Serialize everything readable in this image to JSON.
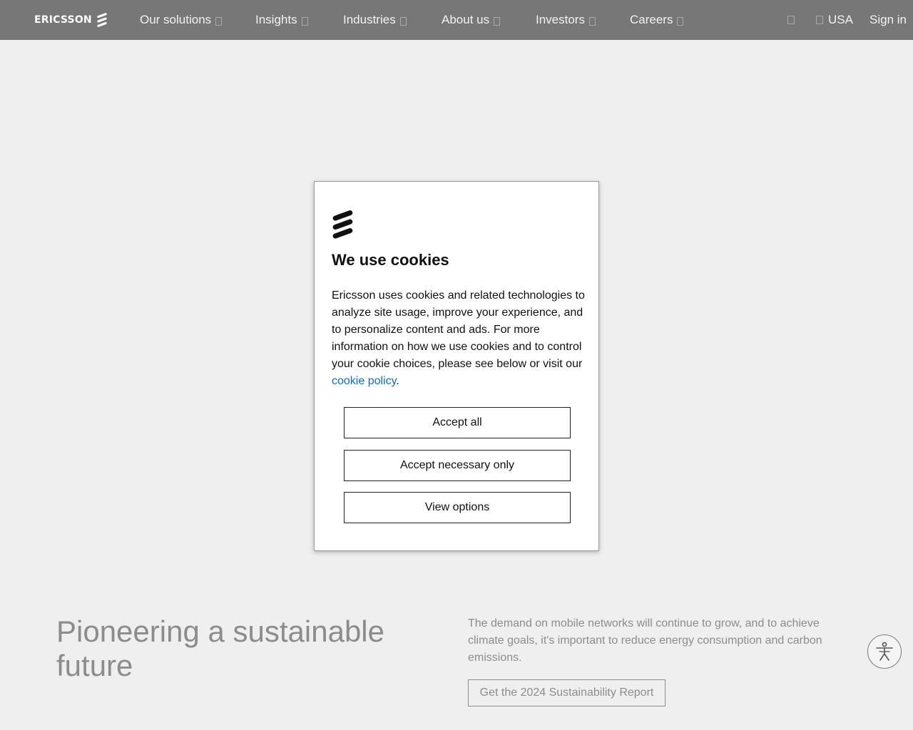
{
  "header": {
    "logo_text": "ERICSSON",
    "nav": [
      {
        "label": "Our solutions"
      },
      {
        "label": "Insights"
      },
      {
        "label": "Industries"
      },
      {
        "label": "About us"
      },
      {
        "label": "Investors"
      },
      {
        "label": "Careers"
      }
    ],
    "region": "USA",
    "sign_in": "Sign in"
  },
  "cookie_modal": {
    "title": "We use cookies",
    "body_text": "Ericsson uses cookies and related technologies to analyze site usage, improve your experience, and to personalize content and ads. For more information on how we use cookies and to control your cookie choices, please see below or visit our ",
    "policy_link": "cookie policy",
    "body_end": ".",
    "buttons": {
      "accept_all": "Accept all",
      "accept_necessary": "Accept necessary only",
      "view_options": "View options"
    }
  },
  "hero": {
    "title": "Pioneering a sustainable future",
    "description": "The demand on mobile networks will continue to grow, and to achieve climate goals, it's important to reduce energy consumption and carbon emissions.",
    "cta": "Get the 2024 Sustainability Report"
  },
  "colors": {
    "header_bg": "#777777",
    "page_bg": "#efefef",
    "link": "#0e6fc0"
  },
  "icons": {
    "logo_mark": "ericsson-logo-icon",
    "nav_chevron": "chevron-down-icon",
    "search": "search-icon",
    "globe": "globe-icon",
    "accessibility": "accessibility-icon"
  }
}
